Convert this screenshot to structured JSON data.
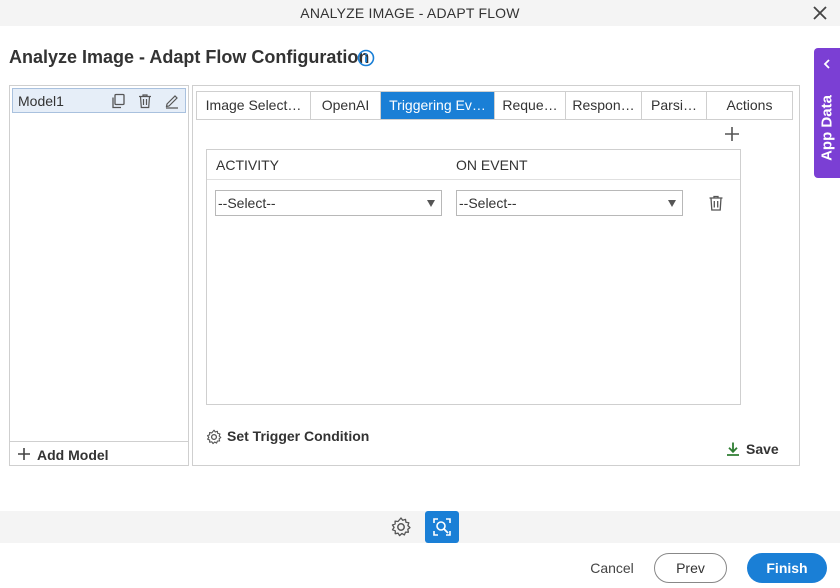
{
  "window": {
    "title": "ANALYZE IMAGE - ADAPT FLOW"
  },
  "page": {
    "title": "Analyze Image - Adapt Flow Configuration"
  },
  "side_tab": {
    "label": "App Data"
  },
  "models": {
    "items": [
      {
        "label": "Model1",
        "selected": true
      }
    ],
    "add_label": "Add Model"
  },
  "tabs": [
    {
      "label": "Image Select…",
      "active": false
    },
    {
      "label": "OpenAI",
      "active": false
    },
    {
      "label": "Triggering Ev…",
      "active": true
    },
    {
      "label": "Reque…",
      "active": false
    },
    {
      "label": "Respon…",
      "active": false
    },
    {
      "label": "Parsi…",
      "active": false
    },
    {
      "label": "Actions",
      "active": false
    }
  ],
  "grid": {
    "columns": [
      "ACTIVITY",
      "ON EVENT"
    ],
    "rows": [
      {
        "activity": "--Select--",
        "on_event": "--Select--"
      }
    ]
  },
  "trigger_condition_label": "Set Trigger Condition",
  "save_label": "Save",
  "footer": {
    "cancel": "Cancel",
    "prev": "Prev",
    "finish": "Finish"
  },
  "colors": {
    "accent": "#1a7fd6",
    "side_tab": "#7b3fd4",
    "save_icon": "#2e7d32"
  }
}
